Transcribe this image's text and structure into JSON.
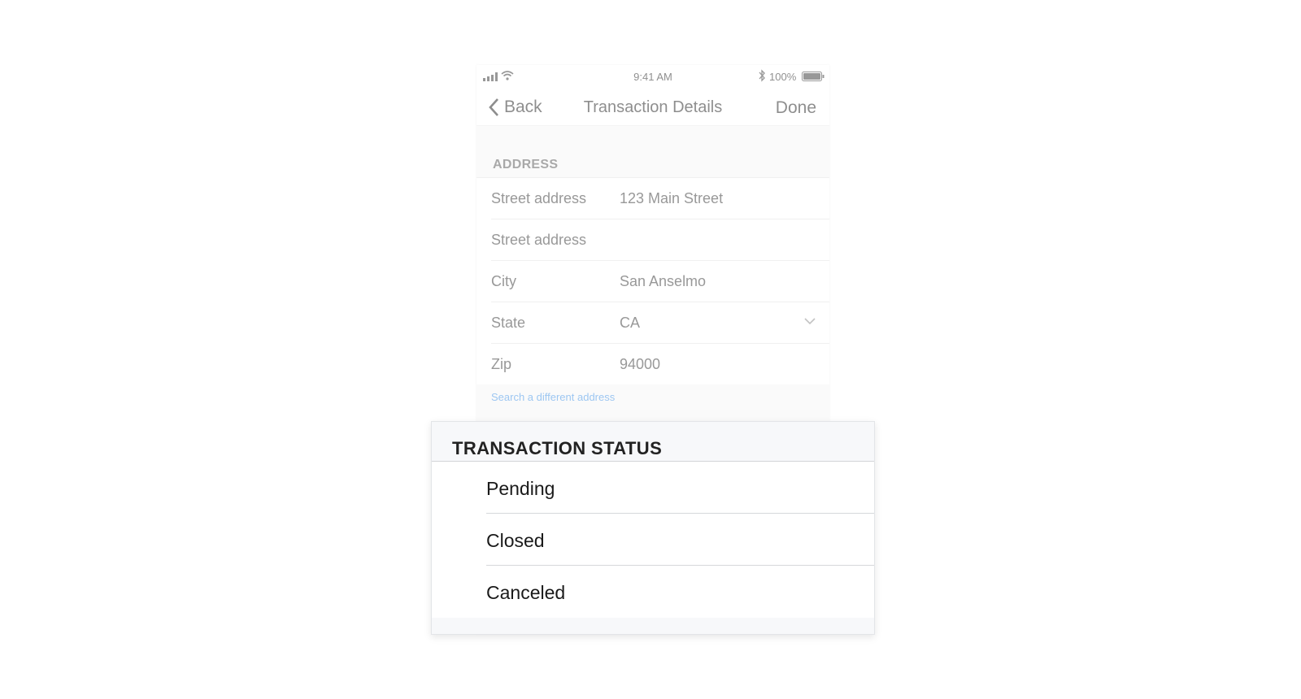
{
  "status_bar": {
    "time": "9:41 AM",
    "battery_percent": "100%",
    "icons": [
      "signal-icon",
      "wifi-icon",
      "bluetooth-icon",
      "battery-icon"
    ]
  },
  "nav": {
    "back_label": "Back",
    "title": "Transaction Details",
    "done_label": "Done"
  },
  "address": {
    "section_title": "ADDRESS",
    "rows": [
      {
        "label": "Street address",
        "value": "123 Main Street"
      },
      {
        "label": "Street address",
        "value": ""
      },
      {
        "label": "City",
        "value": "San Anselmo"
      },
      {
        "label": "State",
        "value": "CA"
      },
      {
        "label": "Zip",
        "value": "94000"
      }
    ],
    "search_link": "Search a different address"
  },
  "status_sheet": {
    "title": "TRANSACTION STATUS",
    "options": [
      "Pending",
      "Closed",
      "Canceled"
    ]
  },
  "colors": {
    "link": "#3b8fe6",
    "sheet_background": "#f7f8fa",
    "divider": "#d6d8db"
  }
}
